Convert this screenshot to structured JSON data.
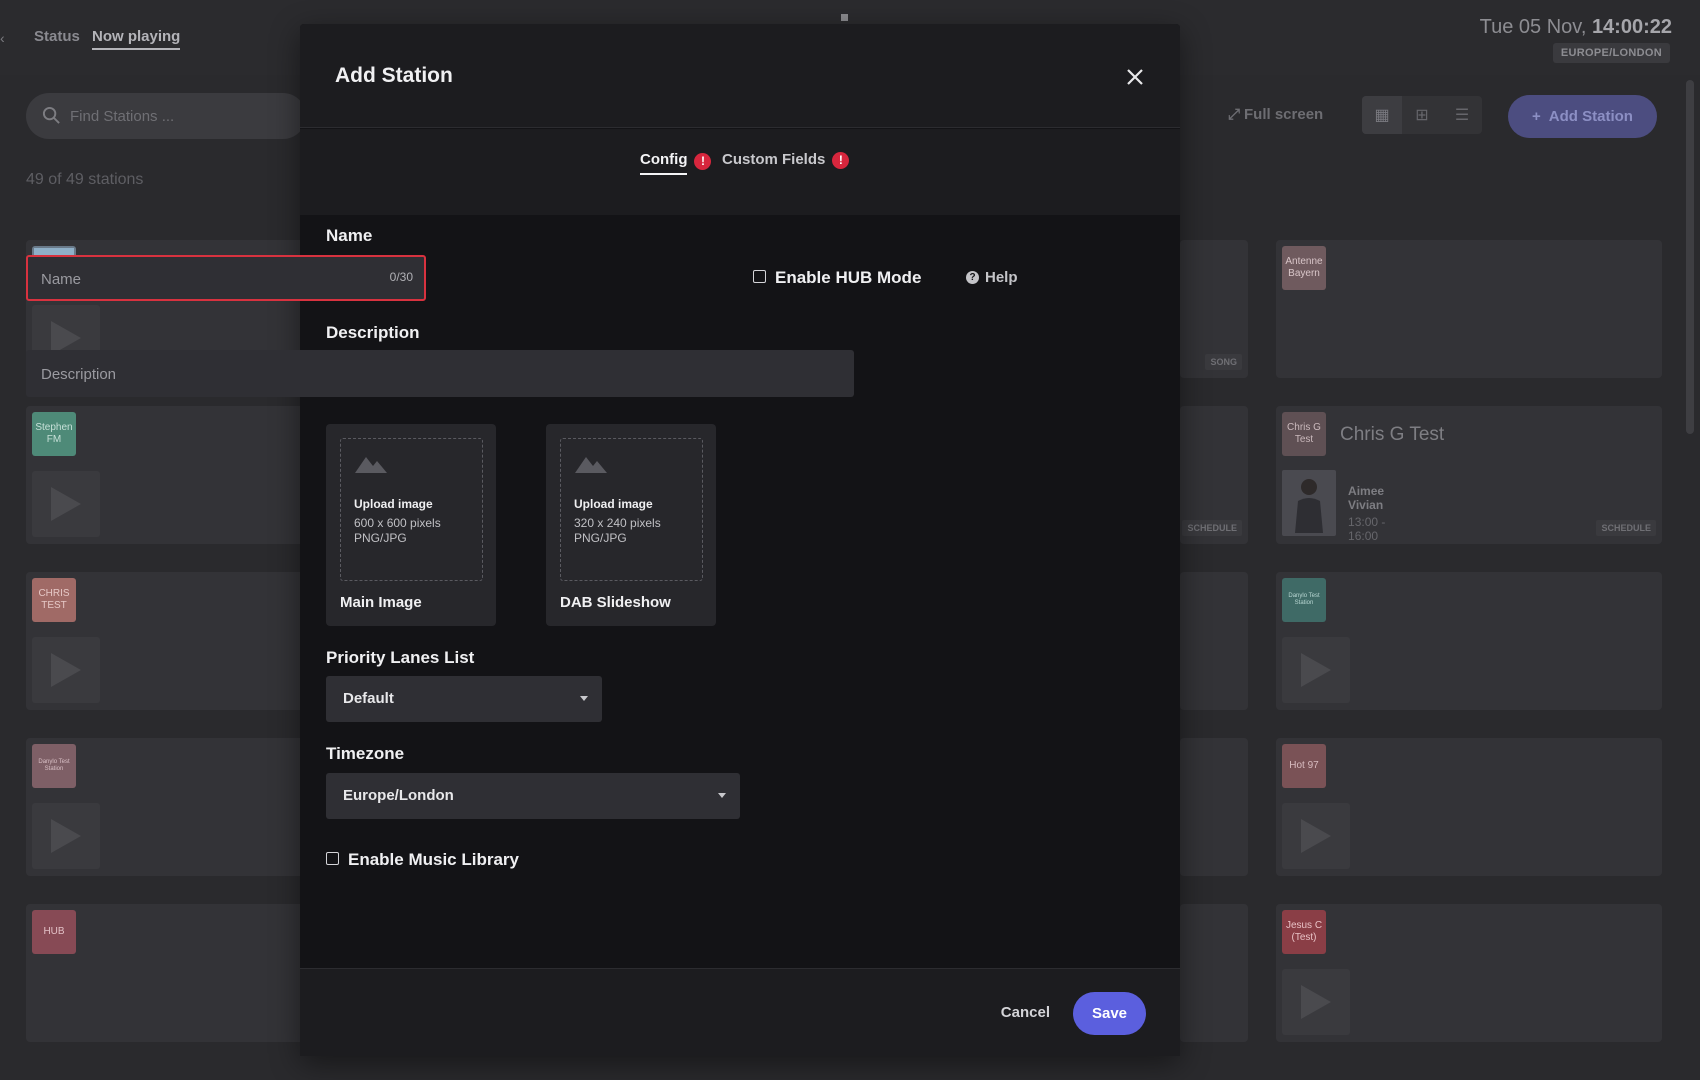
{
  "app": {
    "edge_glyph": "‹",
    "nav": [
      {
        "label": "Status"
      },
      {
        "label": "Now playing"
      }
    ],
    "clock": {
      "date": "Tue 05 Nov,",
      "time": "14:00:22"
    },
    "timezone_badge": "EUROPE/LONDON",
    "search": {
      "placeholder": "Find Stations ..."
    },
    "station_count": "49 of 49 stations",
    "fullscreen_label": "Full screen",
    "add_station_label": "Add Station",
    "cards": {
      "antenne": {
        "logo": "Antenne Bayern"
      },
      "stephen": {
        "logo": "Stephen FM"
      },
      "chrisg": {
        "logo": "Chris G Test",
        "title": "Chris G Test",
        "presenter": "Aimee Vivian",
        "time": "13:00 - 16:00",
        "tag": "SCHEDULE"
      },
      "chris_test": {
        "logo": "CHRIS TEST"
      },
      "danylo1": {
        "logo": "Danylo Test Station"
      },
      "danylo2": {
        "logo": "Danylo Test Station"
      },
      "hot97": {
        "logo": "Hot 97"
      },
      "hub": {
        "logo": "HUB"
      },
      "jesus": {
        "logo": "Jesus C (Test)"
      },
      "song_tag": "SONG",
      "schedule_tag": "SCHEDULE"
    }
  },
  "modal": {
    "title": "Add Station",
    "tabs": [
      {
        "label": "Config",
        "error": "!"
      },
      {
        "label": "Custom Fields",
        "error": "!"
      }
    ],
    "name": {
      "label": "Name",
      "placeholder": "Name",
      "counter": "0/30"
    },
    "hub_mode_label": "Enable HUB Mode",
    "help_label": "Help",
    "description": {
      "label": "Description",
      "placeholder": "Description"
    },
    "uploads": [
      {
        "title": "Upload image",
        "size": "600 x 600 pixels",
        "format": "PNG/JPG",
        "label": "Main Image"
      },
      {
        "title": "Upload image",
        "size": "320 x 240 pixels",
        "format": "PNG/JPG",
        "label": "DAB Slideshow"
      }
    ],
    "priority_lanes": {
      "label": "Priority Lanes List",
      "value": "Default"
    },
    "timezone": {
      "label": "Timezone",
      "value": "Europe/London"
    },
    "music_library_label": "Enable Music Library",
    "cancel_label": "Cancel",
    "save_label": "Save"
  },
  "colors": {
    "accent": "#5b5fde",
    "error": "#d7263d",
    "modal_bg": "#131316",
    "backdrop": "#2a2a2d"
  }
}
